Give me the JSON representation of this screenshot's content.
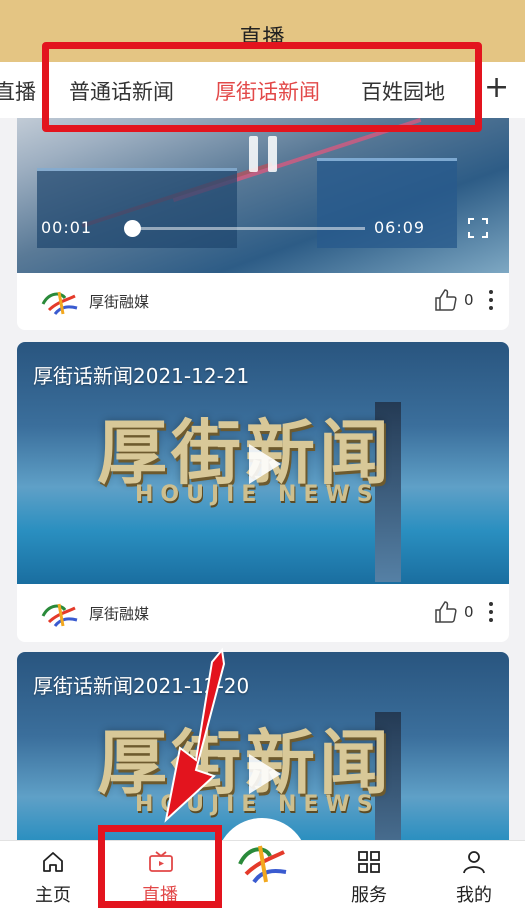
{
  "header": {
    "title": "直播"
  },
  "tabs": [
    {
      "label": "直播",
      "active": false
    },
    {
      "label": "普通话新闻",
      "active": false
    },
    {
      "label": "厚街话新闻",
      "active": true
    },
    {
      "label": "百姓园地",
      "active": false
    }
  ],
  "tab_add_icon": "plus-icon",
  "feed": {
    "cards": [
      {
        "state": "playing",
        "current_time": "00:01",
        "duration": "06:09",
        "progress_fraction": 0.03,
        "source": "厚街融媒",
        "likes": "0"
      },
      {
        "state": "thumbnail",
        "title": "厚街话新闻2021-12-21",
        "logo_text": "厚街新闻",
        "logo_subtext": "HOUJIE NEWS",
        "source": "厚街融媒",
        "likes": "0"
      },
      {
        "state": "thumbnail",
        "title": "厚街话新闻2021-12-20",
        "logo_text": "厚街新闻",
        "logo_subtext": "HOUJIE NEWS"
      }
    ]
  },
  "bottom_nav": [
    {
      "label": "主页",
      "icon": "home-icon",
      "active": false
    },
    {
      "label": "直播",
      "icon": "tv-icon",
      "active": true
    },
    {
      "label": "",
      "icon": "center-logo-icon",
      "active": false
    },
    {
      "label": "服务",
      "icon": "grid-icon",
      "active": false
    },
    {
      "label": "我的",
      "icon": "user-icon",
      "active": false
    }
  ],
  "colors": {
    "header_bg": "#e4c583",
    "accent": "#e24848",
    "annotation": "#e3141e"
  }
}
